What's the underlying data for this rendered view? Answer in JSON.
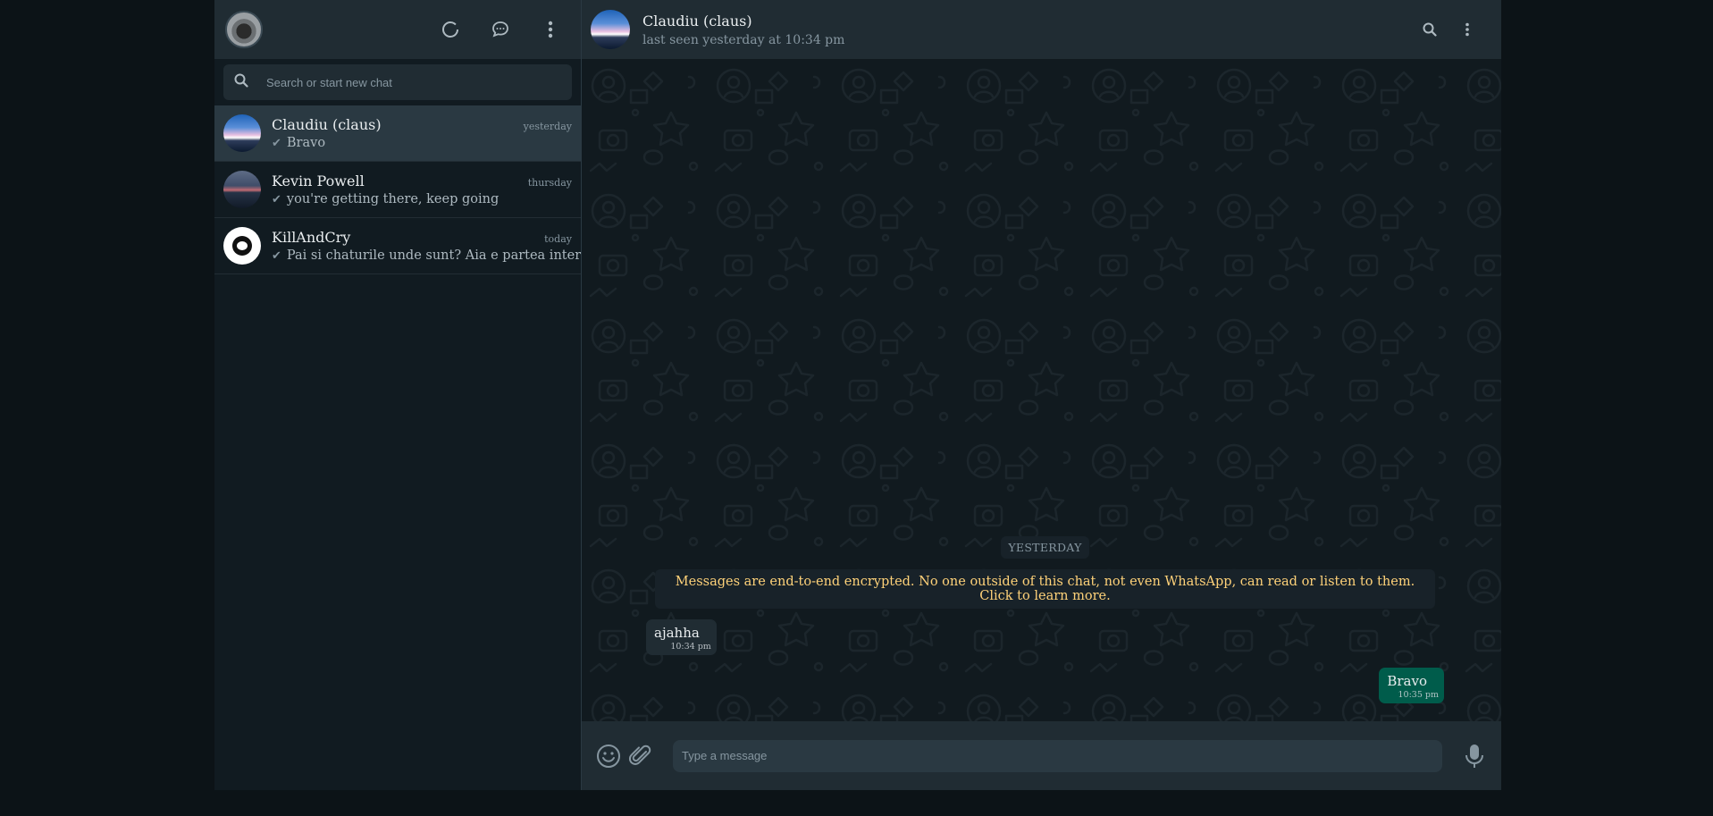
{
  "sidebar": {
    "search_placeholder": "Search or start new chat",
    "chats": [
      {
        "name": "Claudiu (claus)",
        "time": "yesterday",
        "preview": "Bravo",
        "tick": "✔"
      },
      {
        "name": "Kevin Powell",
        "time": "thursday",
        "preview": "you're getting there, keep going",
        "tick": "✔"
      },
      {
        "name": "KillAndCry",
        "time": "today",
        "preview": "Pai si chaturile unde sunt? Aia e partea interesanta",
        "tick": "✔"
      }
    ]
  },
  "conversation": {
    "name": "Claudiu (claus)",
    "status": "last seen yesterday at 10:34 pm",
    "date_chip": "YESTERDAY",
    "encryption_note": "Messages are end-to-end encrypted. No one outside of this chat, not even WhatsApp, can read or listen to them. Click to learn more.",
    "messages": [
      {
        "direction": "in",
        "text": "ajahha",
        "time": "10:34 pm"
      },
      {
        "direction": "out",
        "text": "Bravo",
        "time": "10:35 pm"
      }
    ],
    "composer_placeholder": "Type a message"
  },
  "icons": {
    "status": "status-ring-icon",
    "new_chat": "chat-bubble-icon",
    "menu": "kebab-menu-icon",
    "search": "search-icon",
    "emoji": "emoji-icon",
    "attach": "paperclip-icon",
    "mic": "microphone-icon"
  },
  "colors": {
    "panel": "#202c33",
    "sidebar_bg": "#111b21",
    "outgoing_bubble": "#005c4b",
    "incoming_bubble": "#202c33",
    "encryption_text": "#ffd279"
  }
}
